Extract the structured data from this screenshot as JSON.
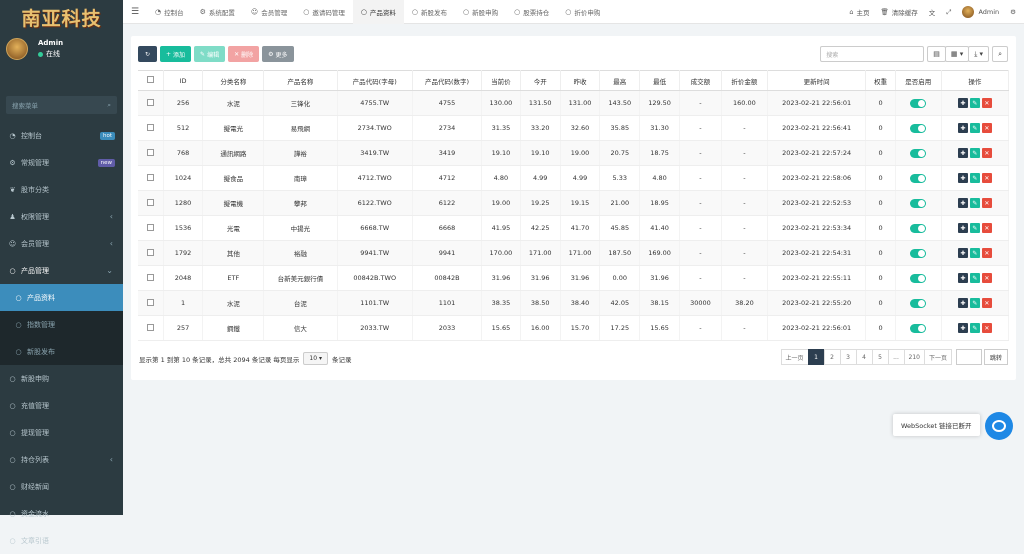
{
  "brand": {
    "logo_text": "南亚科技"
  },
  "user": {
    "name": "Admin",
    "status": "在线"
  },
  "sidebar": {
    "search_placeholder": "搜索菜单",
    "items": [
      {
        "label": "控制台",
        "icon": "dashboard-icon",
        "badge": "hot",
        "badge_color": "#3c8dbc"
      },
      {
        "label": "常规管理",
        "icon": "cogs-icon",
        "badge": "new",
        "badge_color": "#605ca8"
      },
      {
        "label": "股市分类",
        "icon": "leaf-icon"
      },
      {
        "label": "权限管理",
        "icon": "group-icon",
        "arrow": "‹"
      },
      {
        "label": "会员管理",
        "icon": "user-icon",
        "arrow": "‹"
      },
      {
        "label": "产品管理",
        "icon": "circle-icon",
        "arrow": "⌄"
      },
      {
        "label": "产品资料",
        "icon": "circle-icon",
        "sub": true,
        "active": true
      },
      {
        "label": "指数管理",
        "icon": "circle-icon",
        "sub": true
      },
      {
        "label": "新股发布",
        "icon": "circle-icon",
        "sub": true
      },
      {
        "label": "新股申购",
        "icon": "circle-icon"
      },
      {
        "label": "充值管理",
        "icon": "circle-icon"
      },
      {
        "label": "提现管理",
        "icon": "circle-icon"
      },
      {
        "label": "持仓列表",
        "icon": "circle-icon",
        "arrow": "‹"
      },
      {
        "label": "财经新闻",
        "icon": "circle-icon"
      },
      {
        "label": "资金流水",
        "icon": "circle-icon"
      },
      {
        "label": "文章引语",
        "icon": "circle-icon"
      }
    ]
  },
  "topbar": {
    "tabs": [
      {
        "label": "控制台",
        "icon": "dashboard-icon"
      },
      {
        "label": "系统配置",
        "icon": "cog-icon"
      },
      {
        "label": "会员管理",
        "icon": "user-icon"
      },
      {
        "label": "邀请码管理",
        "icon": "circle-icon"
      },
      {
        "label": "产品资料",
        "icon": "circle-icon",
        "active": true
      },
      {
        "label": "新股发布",
        "icon": "circle-icon"
      },
      {
        "label": "新股申购",
        "icon": "circle-icon"
      },
      {
        "label": "股票持仓",
        "icon": "circle-icon"
      },
      {
        "label": "折价申购",
        "icon": "circle-icon"
      }
    ],
    "home_label": "主页",
    "clear_cache_label": "清除缓存",
    "admin_label": "Admin"
  },
  "toolbar": {
    "add_label": "添加",
    "edit_label": "编辑",
    "delete_label": "删除",
    "more_label": "更多",
    "search_placeholder": "搜索"
  },
  "table": {
    "columns": [
      "ID",
      "分类名称",
      "产品名称",
      "产品代码(字母)",
      "产品代码(数字)",
      "当前价",
      "今开",
      "昨收",
      "最高",
      "最低",
      "成交额",
      "折价金额",
      "更新时间",
      "权重",
      "是否启用",
      "操作"
    ],
    "rows": [
      [
        "256",
        "水泥",
        "三锋化",
        "4755.TW",
        "4755",
        "130.00",
        "131.50",
        "131.00",
        "143.50",
        "129.50",
        "-",
        "160.00",
        "2023-02-21 22:56:01",
        "0"
      ],
      [
        "512",
        "擬電光",
        "易飛網",
        "2734.TWO",
        "2734",
        "31.35",
        "33.20",
        "32.60",
        "35.85",
        "31.30",
        "-",
        "-",
        "2023-02-21 22:56:41",
        "0"
      ],
      [
        "768",
        "通訊網路",
        "譁裕",
        "3419.TW",
        "3419",
        "19.10",
        "19.10",
        "19.00",
        "20.75",
        "18.75",
        "-",
        "-",
        "2023-02-21 22:57:24",
        "0"
      ],
      [
        "1024",
        "擬食品",
        "南璋",
        "4712.TWO",
        "4712",
        "4.80",
        "4.99",
        "4.99",
        "5.33",
        "4.80",
        "-",
        "-",
        "2023-02-21 22:58:06",
        "0"
      ],
      [
        "1280",
        "擬電機",
        "攀邦",
        "6122.TWO",
        "6122",
        "19.00",
        "19.25",
        "19.15",
        "21.00",
        "18.95",
        "-",
        "-",
        "2023-02-21 22:52:53",
        "0"
      ],
      [
        "1536",
        "光電",
        "中揚光",
        "6668.TW",
        "6668",
        "41.95",
        "42.25",
        "41.70",
        "45.85",
        "41.40",
        "-",
        "-",
        "2023-02-21 22:53:34",
        "0"
      ],
      [
        "1792",
        "其他",
        "裕融",
        "9941.TW",
        "9941",
        "170.00",
        "171.00",
        "171.00",
        "187.50",
        "169.00",
        "-",
        "-",
        "2023-02-21 22:54:31",
        "0"
      ],
      [
        "2048",
        "ETF",
        "台新美元銀行債",
        "00842B.TWO",
        "00842B",
        "31.96",
        "31.96",
        "31.96",
        "0.00",
        "31.96",
        "-",
        "-",
        "2023-02-21 22:55:11",
        "0"
      ],
      [
        "1",
        "水泥",
        "台泥",
        "1101.TW",
        "1101",
        "38.35",
        "38.50",
        "38.40",
        "42.05",
        "38.15",
        "30000",
        "38.20",
        "2023-02-21 22:55:20",
        "0"
      ],
      [
        "257",
        "鋼鐵",
        "信大",
        "2033.TW",
        "2033",
        "15.65",
        "16.00",
        "15.70",
        "17.25",
        "15.65",
        "-",
        "-",
        "2023-02-21 22:56:01",
        "0"
      ]
    ]
  },
  "pagination": {
    "info_prefix": "显示第 1 到第 10 条记录，总共 2094 条记录 每页显示",
    "page_size": "10",
    "info_suffix": "条记录",
    "prev": "上一页",
    "pages": [
      "1",
      "2",
      "3",
      "4",
      "5",
      "...",
      "210"
    ],
    "next": "下一页",
    "go": "跳转"
  },
  "websocket": {
    "message": "WebSocket 链接已断开"
  },
  "colors": {
    "sidebar_bg": "#2c3b41",
    "accent": "#3c8dbc",
    "green": "#18bc9c",
    "red": "#e74c3c",
    "dark": "#2c3e50"
  }
}
